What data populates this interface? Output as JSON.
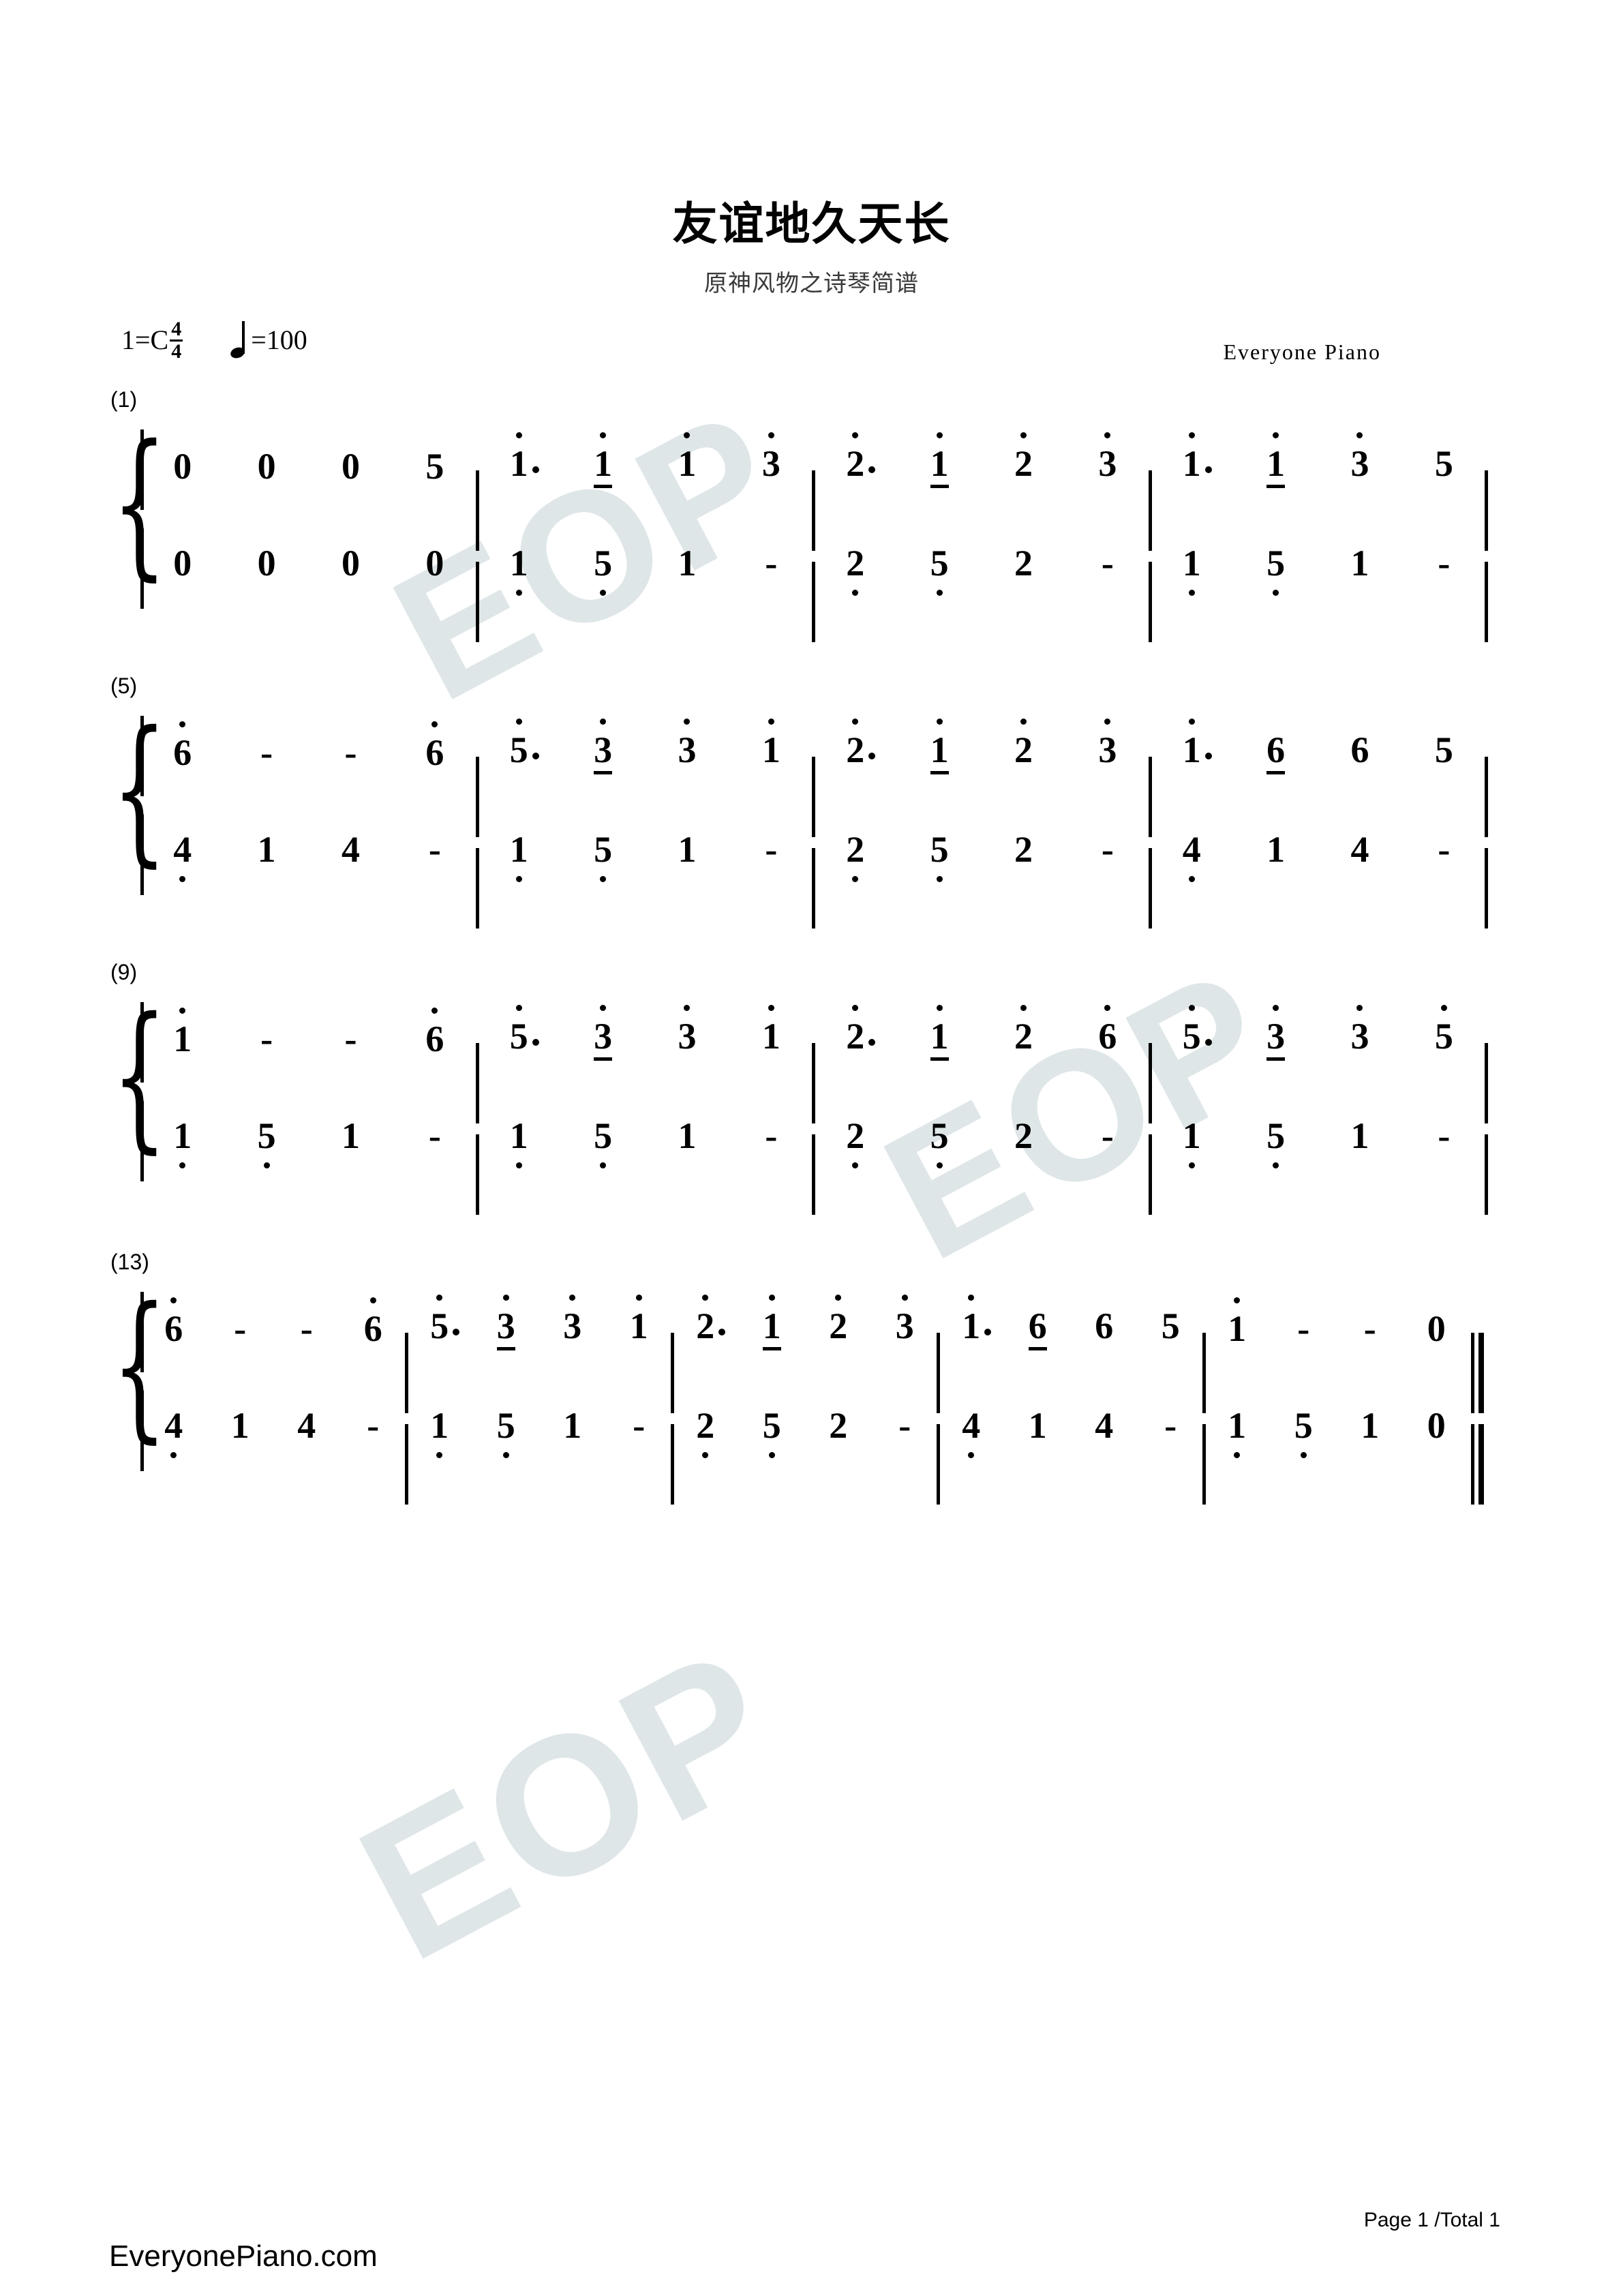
{
  "header": {
    "title": "友谊地久天长",
    "subtitle": "原神风物之诗琴简谱",
    "key_label": "1=C",
    "time_signature": {
      "numerator": "4",
      "denominator": "4"
    },
    "tempo_equals": "=100",
    "tempo_note_icon": "quarter-note-icon",
    "credit": "Everyone Piano"
  },
  "footer": {
    "site": "EveryonePiano.com",
    "page_info": "Page 1 /Total 1"
  },
  "watermarks": [
    "EOP",
    "EOP",
    "EOP"
  ],
  "score": {
    "notation": "jianpu",
    "systems": [
      {
        "number": "(1)",
        "measures": [
          {
            "upper": [
              {
                "d": "0"
              },
              {
                "d": "0"
              },
              {
                "d": "0"
              },
              {
                "d": "5"
              }
            ],
            "lower": [
              {
                "d": "0"
              },
              {
                "d": "0"
              },
              {
                "d": "0"
              },
              {
                "d": "0"
              }
            ]
          },
          {
            "upper": [
              {
                "d": "1",
                "oct": "up",
                "dot": true
              },
              {
                "d": "1",
                "oct": "up",
                "beam": true
              },
              {
                "d": "1",
                "oct": "up"
              },
              {
                "d": "3",
                "oct": "up"
              }
            ],
            "lower": [
              {
                "d": "1",
                "oct": "down"
              },
              {
                "d": "5",
                "oct": "down"
              },
              {
                "d": "1"
              },
              {
                "d": "-"
              }
            ]
          },
          {
            "upper": [
              {
                "d": "2",
                "oct": "up",
                "dot": true
              },
              {
                "d": "1",
                "oct": "up",
                "beam": true
              },
              {
                "d": "2",
                "oct": "up"
              },
              {
                "d": "3",
                "oct": "up"
              }
            ],
            "lower": [
              {
                "d": "2",
                "oct": "down"
              },
              {
                "d": "5",
                "oct": "down"
              },
              {
                "d": "2"
              },
              {
                "d": "-"
              }
            ]
          },
          {
            "upper": [
              {
                "d": "1",
                "oct": "up",
                "dot": true
              },
              {
                "d": "1",
                "oct": "up",
                "beam": true
              },
              {
                "d": "3",
                "oct": "up"
              },
              {
                "d": "5"
              }
            ],
            "lower": [
              {
                "d": "1",
                "oct": "down"
              },
              {
                "d": "5",
                "oct": "down"
              },
              {
                "d": "1"
              },
              {
                "d": "-"
              }
            ]
          }
        ]
      },
      {
        "number": "(5)",
        "measures": [
          {
            "upper": [
              {
                "d": "6",
                "oct": "up"
              },
              {
                "d": "-"
              },
              {
                "d": "-"
              },
              {
                "d": "6",
                "oct": "up"
              }
            ],
            "lower": [
              {
                "d": "4",
                "oct": "down"
              },
              {
                "d": "1"
              },
              {
                "d": "4"
              },
              {
                "d": "-"
              }
            ]
          },
          {
            "upper": [
              {
                "d": "5",
                "oct": "up",
                "dot": true
              },
              {
                "d": "3",
                "oct": "up",
                "beam": true
              },
              {
                "d": "3",
                "oct": "up"
              },
              {
                "d": "1",
                "oct": "up"
              }
            ],
            "lower": [
              {
                "d": "1",
                "oct": "down"
              },
              {
                "d": "5",
                "oct": "down"
              },
              {
                "d": "1"
              },
              {
                "d": "-"
              }
            ]
          },
          {
            "upper": [
              {
                "d": "2",
                "oct": "up",
                "dot": true
              },
              {
                "d": "1",
                "oct": "up",
                "beam": true
              },
              {
                "d": "2",
                "oct": "up"
              },
              {
                "d": "3",
                "oct": "up"
              }
            ],
            "lower": [
              {
                "d": "2",
                "oct": "down"
              },
              {
                "d": "5",
                "oct": "down"
              },
              {
                "d": "2"
              },
              {
                "d": "-"
              }
            ]
          },
          {
            "upper": [
              {
                "d": "1",
                "oct": "up",
                "dot": true
              },
              {
                "d": "6",
                "beam": true
              },
              {
                "d": "6"
              },
              {
                "d": "5"
              }
            ],
            "lower": [
              {
                "d": "4",
                "oct": "down"
              },
              {
                "d": "1"
              },
              {
                "d": "4"
              },
              {
                "d": "-"
              }
            ]
          }
        ]
      },
      {
        "number": "(9)",
        "measures": [
          {
            "upper": [
              {
                "d": "1",
                "oct": "up"
              },
              {
                "d": "-"
              },
              {
                "d": "-"
              },
              {
                "d": "6",
                "oct": "up"
              }
            ],
            "lower": [
              {
                "d": "1",
                "oct": "down"
              },
              {
                "d": "5",
                "oct": "down"
              },
              {
                "d": "1"
              },
              {
                "d": "-"
              }
            ]
          },
          {
            "upper": [
              {
                "d": "5",
                "oct": "up",
                "dot": true
              },
              {
                "d": "3",
                "oct": "up",
                "beam": true
              },
              {
                "d": "3",
                "oct": "up"
              },
              {
                "d": "1",
                "oct": "up"
              }
            ],
            "lower": [
              {
                "d": "1",
                "oct": "down"
              },
              {
                "d": "5",
                "oct": "down"
              },
              {
                "d": "1"
              },
              {
                "d": "-"
              }
            ]
          },
          {
            "upper": [
              {
                "d": "2",
                "oct": "up",
                "dot": true
              },
              {
                "d": "1",
                "oct": "up",
                "beam": true
              },
              {
                "d": "2",
                "oct": "up"
              },
              {
                "d": "6",
                "oct": "up"
              }
            ],
            "lower": [
              {
                "d": "2",
                "oct": "down"
              },
              {
                "d": "5",
                "oct": "down"
              },
              {
                "d": "2"
              },
              {
                "d": "-"
              }
            ]
          },
          {
            "upper": [
              {
                "d": "5",
                "oct": "up",
                "dot": true
              },
              {
                "d": "3",
                "oct": "up",
                "beam": true
              },
              {
                "d": "3",
                "oct": "up"
              },
              {
                "d": "5",
                "oct": "up"
              }
            ],
            "lower": [
              {
                "d": "1",
                "oct": "down"
              },
              {
                "d": "5",
                "oct": "down"
              },
              {
                "d": "1"
              },
              {
                "d": "-"
              }
            ]
          }
        ]
      },
      {
        "number": "(13)",
        "final": true,
        "measures": [
          {
            "upper": [
              {
                "d": "6",
                "oct": "up"
              },
              {
                "d": "-"
              },
              {
                "d": "-"
              },
              {
                "d": "6",
                "oct": "up"
              }
            ],
            "lower": [
              {
                "d": "4",
                "oct": "down"
              },
              {
                "d": "1"
              },
              {
                "d": "4"
              },
              {
                "d": "-"
              }
            ]
          },
          {
            "upper": [
              {
                "d": "5",
                "oct": "up",
                "dot": true
              },
              {
                "d": "3",
                "oct": "up",
                "beam": true
              },
              {
                "d": "3",
                "oct": "up"
              },
              {
                "d": "1",
                "oct": "up"
              }
            ],
            "lower": [
              {
                "d": "1",
                "oct": "down"
              },
              {
                "d": "5",
                "oct": "down"
              },
              {
                "d": "1"
              },
              {
                "d": "-"
              }
            ]
          },
          {
            "upper": [
              {
                "d": "2",
                "oct": "up",
                "dot": true
              },
              {
                "d": "1",
                "oct": "up",
                "beam": true
              },
              {
                "d": "2",
                "oct": "up"
              },
              {
                "d": "3",
                "oct": "up"
              }
            ],
            "lower": [
              {
                "d": "2",
                "oct": "down"
              },
              {
                "d": "5",
                "oct": "down"
              },
              {
                "d": "2"
              },
              {
                "d": "-"
              }
            ]
          },
          {
            "upper": [
              {
                "d": "1",
                "oct": "up",
                "dot": true
              },
              {
                "d": "6",
                "beam": true
              },
              {
                "d": "6"
              },
              {
                "d": "5"
              }
            ],
            "lower": [
              {
                "d": "4",
                "oct": "down"
              },
              {
                "d": "1"
              },
              {
                "d": "4"
              },
              {
                "d": "-"
              }
            ]
          },
          {
            "upper": [
              {
                "d": "1",
                "oct": "up"
              },
              {
                "d": "-"
              },
              {
                "d": "-"
              },
              {
                "d": "0"
              }
            ],
            "lower": [
              {
                "d": "1",
                "oct": "down"
              },
              {
                "d": "5",
                "oct": "down"
              },
              {
                "d": "1"
              },
              {
                "d": "0"
              }
            ]
          }
        ]
      }
    ]
  }
}
